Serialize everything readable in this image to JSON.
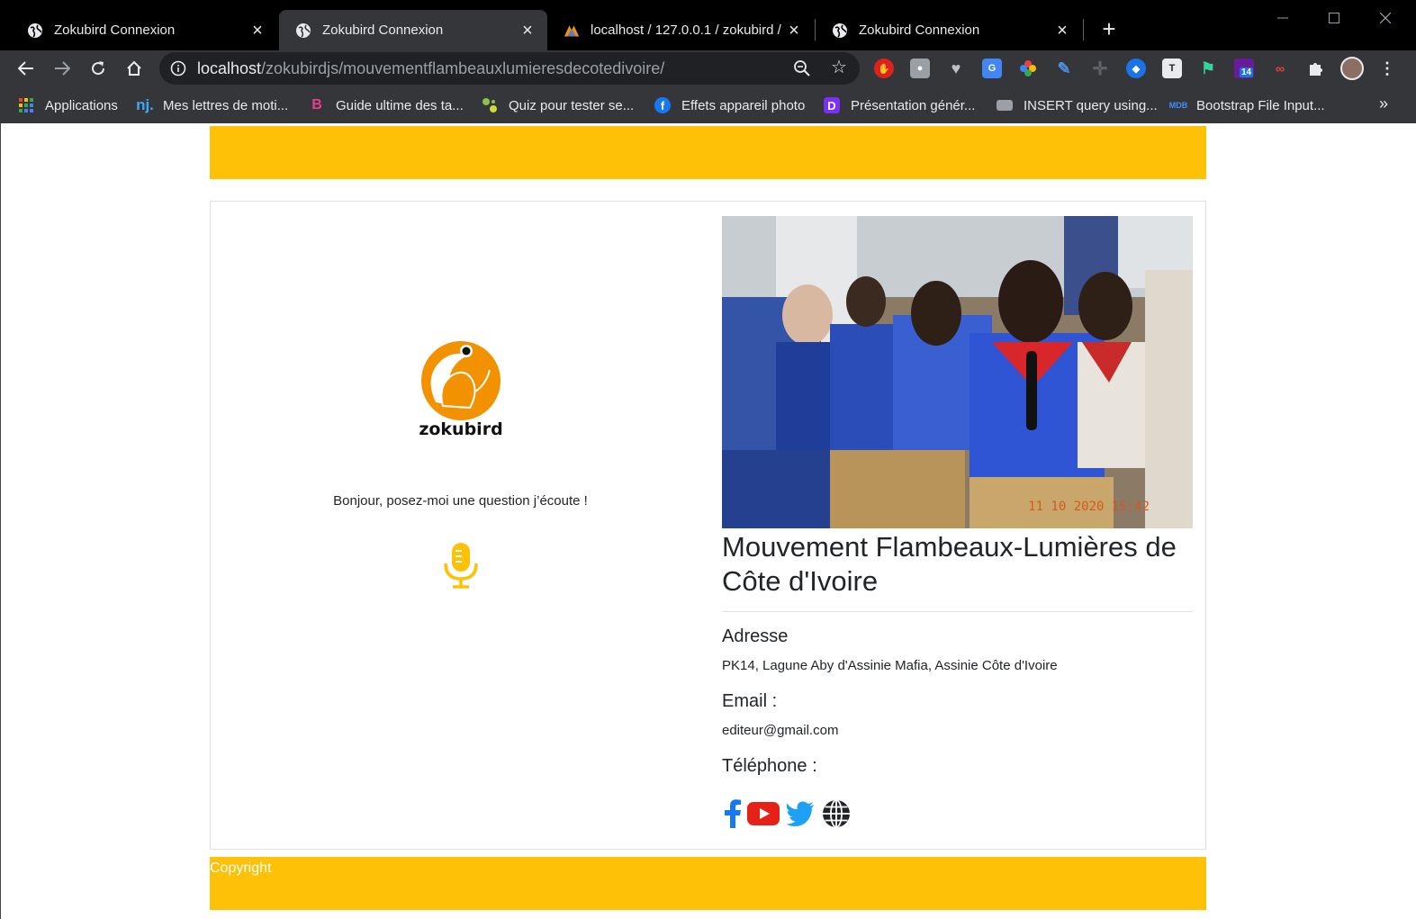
{
  "browser": {
    "tabs": [
      {
        "title": "Zokubird Connexion",
        "icon": "globe-icon",
        "active": false
      },
      {
        "title": "Zokubird Connexion",
        "icon": "globe-icon",
        "active": true
      },
      {
        "title": "localhost / 127.0.0.1 / zokubird /",
        "icon": "phpmyadmin-icon",
        "active": false
      },
      {
        "title": "Zokubird Connexion",
        "icon": "globe-icon",
        "active": false
      }
    ],
    "url_host": "localhost",
    "url_path": "/zokubirdjs/mouvementflambeauxlumieresdecotedivoire/",
    "extension_badge": "14",
    "bookmarks": [
      {
        "label": "Applications",
        "icon": "apps-grid-icon"
      },
      {
        "label": "Mes lettres de moti...",
        "icon": "nj-icon",
        "icon_text": "nj."
      },
      {
        "label": "Guide ultime des ta...",
        "icon": "bootstrap-icon",
        "icon_text": "B"
      },
      {
        "label": "Quiz pour tester se...",
        "icon": "quiz-icon"
      },
      {
        "label": "Effets appareil photo",
        "icon": "facebook-icon"
      },
      {
        "label": "Présentation génér...",
        "icon": "presentation-icon"
      },
      {
        "label": "INSERT query using...",
        "icon": "database-icon"
      },
      {
        "label": "Bootstrap File Input...",
        "icon": "mdb-icon",
        "icon_text": "MDB"
      }
    ],
    "bookmarks_more": "»"
  },
  "page": {
    "logo_text": "zokubird",
    "prompt": "Bonjour, posez-moi une question j’écoute !",
    "photo_timestamp": "11 10 2020 15:42",
    "org_name": "Mouvement Flambeaux-Lumières de Côte d'Ivoire",
    "address_label": "Adresse",
    "address_value": "PK14, Lagune Aby d'Assinie Mafia, Assinie Côte d'Ivoire",
    "email_label": "Email :",
    "email_value": "editeur@gmail.com",
    "phone_label": "Téléphone :",
    "phone_value": "",
    "social": [
      "facebook-icon",
      "youtube-icon",
      "twitter-icon",
      "website-icon"
    ],
    "footer": "Copyright"
  },
  "colors": {
    "brand_yellow": "#ffc107",
    "logo_orange": "#f39200",
    "facebook": "#1877f2",
    "youtube": "#e62117",
    "twitter": "#1da1f2"
  }
}
